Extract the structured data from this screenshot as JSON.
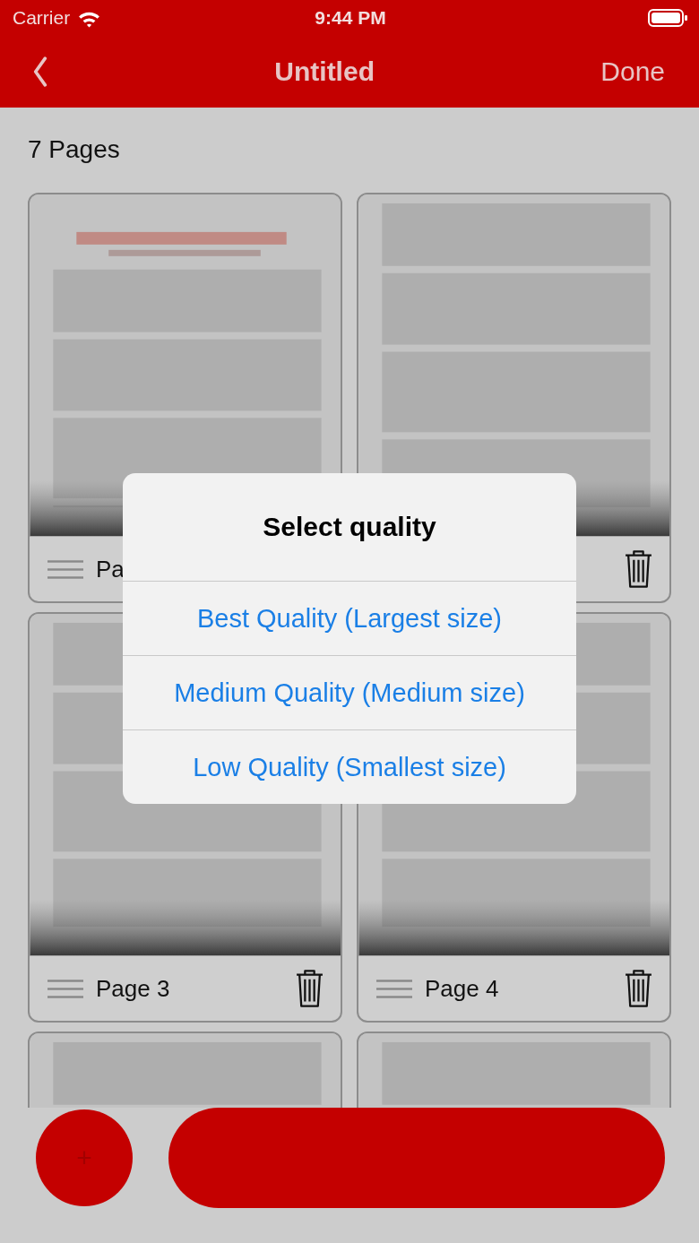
{
  "status_bar": {
    "carrier": "Carrier",
    "time": "9:44 PM"
  },
  "nav_bar": {
    "title": "Untitled",
    "done": "Done"
  },
  "page_count": "7 Pages",
  "pages": [
    {
      "label": "Pa",
      "drag_handle": true,
      "delete_button": false,
      "kind": "title-page"
    },
    {
      "drag_handle": false,
      "delete_button": true,
      "kind": "text-page"
    },
    {
      "label": "Page 3",
      "drag_handle": true,
      "delete_button": true,
      "kind": "text-page"
    },
    {
      "label": "Page 4",
      "drag_handle": true,
      "delete_button": true,
      "kind": "text-page"
    },
    {
      "drag_handle": false,
      "delete_button": false,
      "kind": "text-page"
    },
    {
      "drag_handle": false,
      "delete_button": false,
      "kind": "text-page"
    }
  ],
  "dialog": {
    "title": "Select quality",
    "options": [
      "Best Quality (Largest size)",
      "Medium Quality (Medium size)",
      "Low Quality (Smallest size)"
    ]
  },
  "bottom_bar": {
    "add_button": "+"
  }
}
